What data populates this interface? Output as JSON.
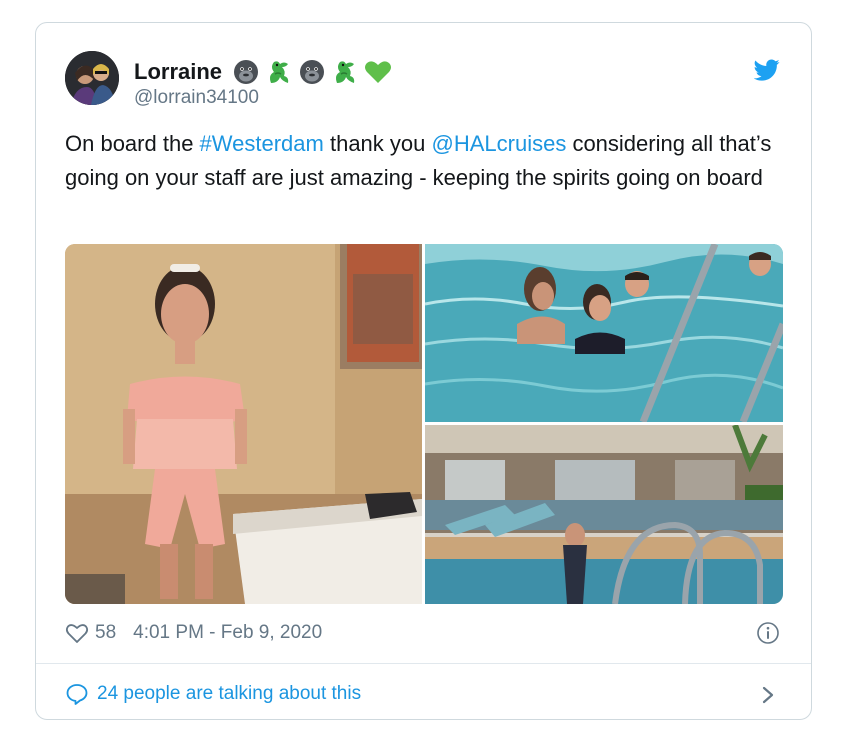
{
  "tweet": {
    "author_name": "Lorraine",
    "author_handle": "@lorrain34100",
    "name_emojis": [
      "gorilla-emoji",
      "dragon-emoji",
      "gorilla-emoji",
      "dragon-emoji",
      "green-heart-emoji"
    ],
    "text_parts": {
      "p1": "On board the ",
      "hashtag": "#Westerdam",
      "p2": " thank you ",
      "mention": "@HALcruises",
      "p3": " considering all that’s going on your staff are just amazing - keeping the spirits going on board"
    },
    "like_count": "58",
    "timestamp": "4:01 PM - Feb 9, 2020",
    "conversation_label": "24 people are talking about this"
  },
  "colors": {
    "link": "#1b95e0",
    "secondary_text": "#657786",
    "border": "#cfd9de",
    "twitter_blue": "#1da1f2"
  }
}
